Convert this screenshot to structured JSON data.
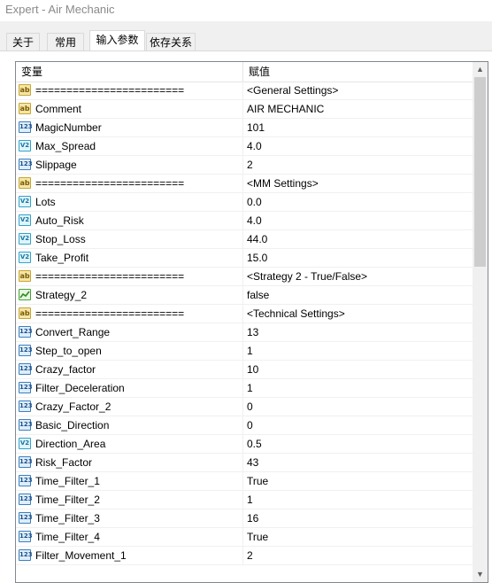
{
  "window": {
    "title": "Expert - Air Mechanic"
  },
  "tabs": [
    {
      "label": "关于"
    },
    {
      "label": "常用"
    },
    {
      "label": "输入参数"
    },
    {
      "label": "依存关系"
    }
  ],
  "grid": {
    "col_variable": "变量",
    "col_value": "赋值",
    "rows": [
      {
        "icon": "text-icon",
        "name": "========================",
        "value": "<General Settings>"
      },
      {
        "icon": "text-icon",
        "name": "Comment",
        "value": "AIR MECHANIC"
      },
      {
        "icon": "integer-icon",
        "name": "MagicNumber",
        "value": "101"
      },
      {
        "icon": "double-icon",
        "name": "Max_Spread",
        "value": "4.0"
      },
      {
        "icon": "integer-icon",
        "name": "Slippage",
        "value": "2"
      },
      {
        "icon": "text-icon",
        "name": "========================",
        "value": "<MM Settings>"
      },
      {
        "icon": "double-icon",
        "name": "Lots",
        "value": "0.0"
      },
      {
        "icon": "double-icon",
        "name": "Auto_Risk",
        "value": "4.0"
      },
      {
        "icon": "double-icon",
        "name": "Stop_Loss",
        "value": "44.0"
      },
      {
        "icon": "double-icon",
        "name": "Take_Profit",
        "value": "15.0"
      },
      {
        "icon": "text-icon",
        "name": "========================",
        "value": "<Strategy 2 - True/False>"
      },
      {
        "icon": "bool-icon",
        "name": "Strategy_2",
        "value": "false"
      },
      {
        "icon": "text-icon",
        "name": "========================",
        "value": "<Technical Settings>"
      },
      {
        "icon": "integer-icon",
        "name": "Convert_Range",
        "value": "13"
      },
      {
        "icon": "integer-icon",
        "name": "Step_to_open",
        "value": "1"
      },
      {
        "icon": "integer-icon",
        "name": "Crazy_factor",
        "value": "10"
      },
      {
        "icon": "integer-icon",
        "name": "Filter_Deceleration",
        "value": "1"
      },
      {
        "icon": "integer-icon",
        "name": "Crazy_Factor_2",
        "value": "0"
      },
      {
        "icon": "integer-icon",
        "name": "Basic_Direction",
        "value": "0"
      },
      {
        "icon": "double-icon",
        "name": "Direction_Area",
        "value": "0.5"
      },
      {
        "icon": "integer-icon",
        "name": "Risk_Factor",
        "value": "43"
      },
      {
        "icon": "integer-icon",
        "name": "Time_Filter_1",
        "value": "True"
      },
      {
        "icon": "integer-icon",
        "name": "Time_Filter_2",
        "value": "1"
      },
      {
        "icon": "integer-icon",
        "name": "Time_Filter_3",
        "value": "16"
      },
      {
        "icon": "integer-icon",
        "name": "Time_Filter_4",
        "value": "True"
      },
      {
        "icon": "integer-icon",
        "name": "Filter_Movement_1",
        "value": "2"
      }
    ]
  },
  "scrollbar": {
    "up_icon": "scroll-up-icon",
    "down_icon": "scroll-down-icon"
  }
}
